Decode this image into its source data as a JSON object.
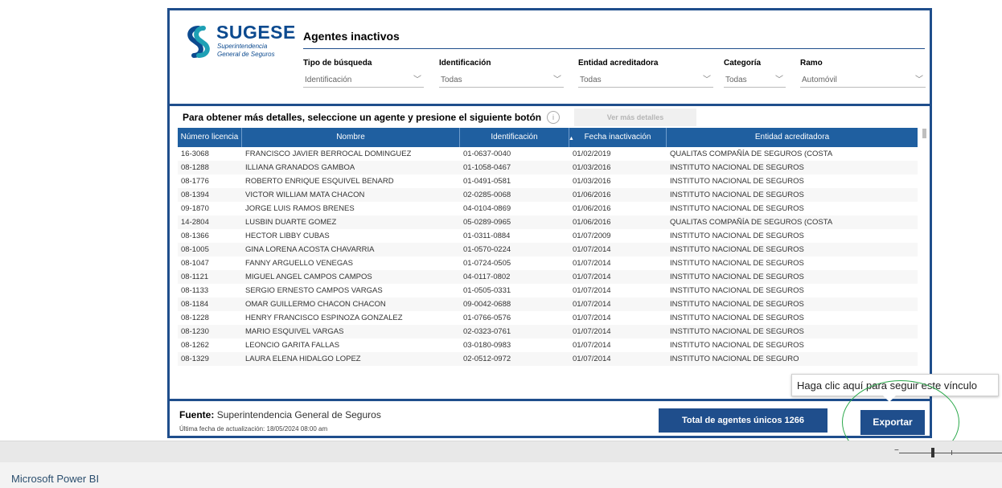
{
  "logo": {
    "brand": "SUGESE",
    "sub1": "Superintendencia",
    "sub2": "General de Seguros"
  },
  "title": "Agentes inactivos",
  "filters": [
    {
      "label": "Tipo de búsqueda",
      "value": "Identificación"
    },
    {
      "label": "Identificación",
      "value": "Todas"
    },
    {
      "label": "Entidad acreditadora",
      "value": "Todas"
    },
    {
      "label": "Categoría",
      "value": "Todas"
    },
    {
      "label": "Ramo",
      "value": "Automóvil"
    }
  ],
  "instruction": "Para obtener más detalles, seleccione un agente y presione el siguiente botón",
  "more_details_label": "Ver más detalles",
  "table": {
    "headers": [
      "Número licencia",
      "Nombre",
      "Identificación",
      "Fecha inactivación",
      "Entidad acreditadora"
    ],
    "rows": [
      [
        "16-3068",
        "FRANCISCO JAVIER BERROCAL DOMINGUEZ",
        "01-0637-0040",
        "01/02/2019",
        "QUALITAS COMPAÑÍA DE SEGUROS (COSTA"
      ],
      [
        "08-1288",
        "ILLIANA GRANADOS GAMBOA",
        "01-1058-0467",
        "01/03/2016",
        "INSTITUTO NACIONAL DE SEGUROS"
      ],
      [
        "08-1776",
        "ROBERTO ENRIQUE ESQUIVEL BENARD",
        "01-0491-0581",
        "01/03/2016",
        "INSTITUTO NACIONAL DE SEGUROS"
      ],
      [
        "08-1394",
        "VICTOR WILLIAM MATA CHACON",
        "02-0285-0068",
        "01/06/2016",
        "INSTITUTO NACIONAL DE SEGUROS"
      ],
      [
        "09-1870",
        "JORGE LUIS RAMOS BRENES",
        "04-0104-0869",
        "01/06/2016",
        "INSTITUTO NACIONAL DE SEGUROS"
      ],
      [
        "14-2804",
        "LUSBIN DUARTE GOMEZ",
        "05-0289-0965",
        "01/06/2016",
        "QUALITAS COMPAÑÍA DE SEGUROS (COSTA"
      ],
      [
        "08-1366",
        "HECTOR LIBBY CUBAS",
        "01-0311-0884",
        "01/07/2009",
        "INSTITUTO NACIONAL DE SEGUROS"
      ],
      [
        "08-1005",
        "GINA LORENA ACOSTA CHAVARRIA",
        "01-0570-0224",
        "01/07/2014",
        "INSTITUTO NACIONAL DE SEGUROS"
      ],
      [
        "08-1047",
        "FANNY ARGUELLO VENEGAS",
        "01-0724-0505",
        "01/07/2014",
        "INSTITUTO NACIONAL DE SEGUROS"
      ],
      [
        "08-1121",
        "MIGUEL ANGEL CAMPOS CAMPOS",
        "04-0117-0802",
        "01/07/2014",
        "INSTITUTO NACIONAL DE SEGUROS"
      ],
      [
        "08-1133",
        "SERGIO ERNESTO CAMPOS VARGAS",
        "01-0505-0331",
        "01/07/2014",
        "INSTITUTO NACIONAL DE SEGUROS"
      ],
      [
        "08-1184",
        "OMAR GUILLERMO CHACON CHACON",
        "09-0042-0688",
        "01/07/2014",
        "INSTITUTO NACIONAL DE SEGUROS"
      ],
      [
        "08-1228",
        "HENRY FRANCISCO ESPINOZA GONZALEZ",
        "01-0766-0576",
        "01/07/2014",
        "INSTITUTO NACIONAL DE SEGUROS"
      ],
      [
        "08-1230",
        "MARIO ESQUIVEL VARGAS",
        "02-0323-0761",
        "01/07/2014",
        "INSTITUTO NACIONAL DE SEGUROS"
      ],
      [
        "08-1262",
        "LEONCIO GARITA FALLAS",
        "03-0180-0983",
        "01/07/2014",
        "INSTITUTO NACIONAL DE SEGUROS"
      ],
      [
        "08-1329",
        "LAURA ELENA HIDALGO LOPEZ",
        "02-0512-0972",
        "01/07/2014",
        "INSTITUTO NACIONAL DE SEGURO"
      ]
    ]
  },
  "footer": {
    "source_label": "Fuente:",
    "source_value": "Superintendencia General de Seguros",
    "updated": "Última fecha de actualización: 18/05/2024 08:00 am",
    "total": "Total de agentes únicos 1266",
    "export": "Exportar"
  },
  "tooltip": "Haga clic aquí para seguir este vínculo",
  "app_name": "Microsoft Power BI",
  "colors": {
    "primary": "#1f4e8c",
    "header": "#1f5fa0",
    "highlight": "#2aa84a"
  }
}
